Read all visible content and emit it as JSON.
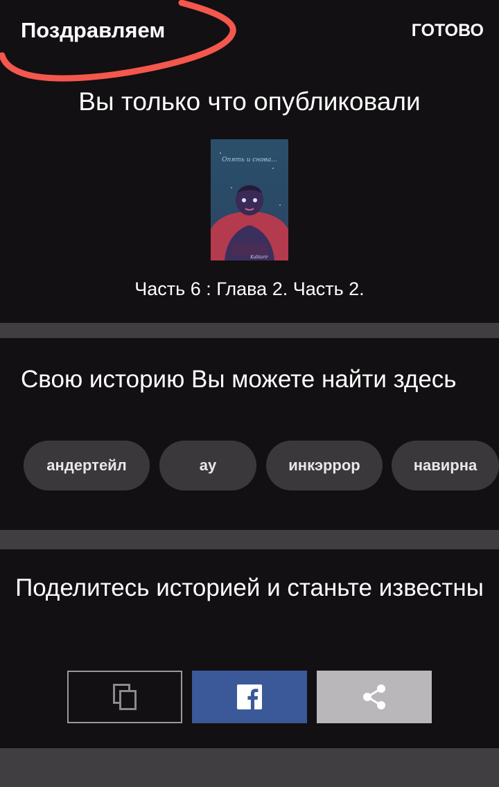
{
  "header": {
    "title": "Поздравляем",
    "done_label": "ГОТОВО"
  },
  "published": {
    "title": "Вы только что опубликовали",
    "cover": {
      "title": "Опять и снова...",
      "author": "Kalitarir",
      "icon": "book-cover-image"
    },
    "part_title": "Часть 6 : Глава 2. Часть 2."
  },
  "find": {
    "title": "Свою историю Вы можете найти здесь",
    "tags": [
      {
        "label": "андертейл"
      },
      {
        "label": "ау"
      },
      {
        "label": "инкэррор"
      },
      {
        "label": "навирна"
      }
    ]
  },
  "share": {
    "title": "Поделитесь историей и станьте известны",
    "buttons": [
      {
        "icon": "copy-icon"
      },
      {
        "icon": "facebook-icon"
      },
      {
        "icon": "share-icon"
      }
    ]
  },
  "colors": {
    "background": "#121012",
    "divider": "#403e40",
    "tag_background": "#3a383a",
    "facebook": "#3b5998",
    "share_button": "#b9b7b9",
    "scribble": "#f4574d"
  }
}
